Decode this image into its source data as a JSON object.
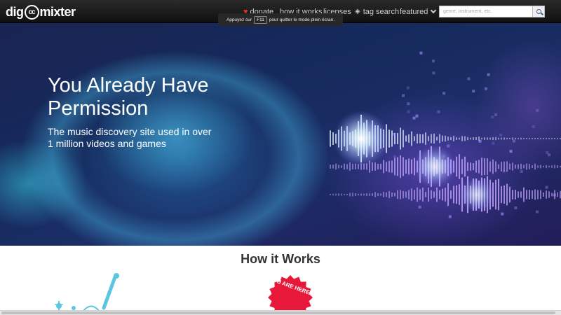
{
  "brand": {
    "logo_pre": "dig",
    "logo_cc": "cc",
    "logo_post": "mixter"
  },
  "nav": {
    "donate": "donate",
    "how_it_works": "how it works",
    "licenses": "licenses",
    "tag_search": "tag search",
    "featured": "featured"
  },
  "search": {
    "placeholder": "genre, instrument, etc."
  },
  "fullscreen_tip": {
    "before": "Appuyez sur",
    "key": "F11",
    "after": "pour quitter le mode plein écran."
  },
  "hero": {
    "title": "You Already Have Permission",
    "subtitle": "The music discovery site used in over 1 million videos and games"
  },
  "how": {
    "title": "How it Works",
    "badge": "YOU ARE HERE!"
  },
  "colors": {
    "navbar": "#161616",
    "heart": "#e0302e",
    "badge": "#e8183a",
    "hero_accent": "#5ad7ff"
  }
}
